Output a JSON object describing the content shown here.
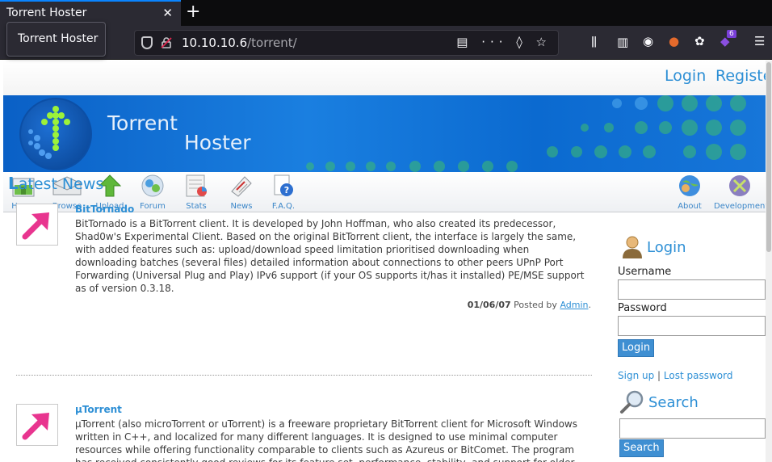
{
  "browser": {
    "tab_title": "Torrent Hoster",
    "tooltip": "Torrent Hoster",
    "url_host": "10.10.10.6",
    "url_path": "/torrent/",
    "extension_badge": "6"
  },
  "site": {
    "top_links": {
      "login": "Login",
      "register": "Register"
    },
    "banner": {
      "title_line1": "Torrent",
      "title_line2": "Hoster"
    },
    "nav": [
      {
        "label": "Home",
        "icon": "home-icon"
      },
      {
        "label": "Browse",
        "icon": "browse-icon"
      },
      {
        "label": "Upload",
        "icon": "upload-icon"
      },
      {
        "label": "Forum",
        "icon": "forum-icon"
      },
      {
        "label": "Stats",
        "icon": "stats-icon"
      },
      {
        "label": "News",
        "icon": "news-icon"
      },
      {
        "label": "F.A.Q.",
        "icon": "faq-icon"
      }
    ],
    "nav_right": [
      {
        "label": "About",
        "icon": "about-icon"
      },
      {
        "label": "Development",
        "icon": "development-icon"
      }
    ]
  },
  "news": {
    "heading_first": "L",
    "heading_rest": "atest News",
    "items": [
      {
        "title": "BitTornado",
        "body": "BitTornado is a BitTorrent client. It is developed by John Hoffman, who also created its predecessor, Shad0w's Experimental Client. Based on the original BitTorrent client, the interface is largely the same, with added features such as: upload/download speed limitation prioritised downloading when downloading batches (several files) detailed information about connections to other peers UPnP Port Forwarding (Universal Plug and Play) IPv6 support (if your OS supports it/has it installed) PE/MSE support as of version 0.3.18.",
        "date": "01/06/07",
        "posted_by": "Posted by",
        "author": "Admin"
      },
      {
        "title": "µTorrent",
        "body": "µTorrent (also microTorrent or uTorrent) is a freeware proprietary BitTorrent client for Microsoft Windows written in C++, and localized for many different languages. It is designed to use minimal computer resources while offering functionality comparable to clients such as Azureus or BitComet. The program has received consistently good reviews for its feature set, performance, stability, and support for older hardware and"
      }
    ]
  },
  "sidebar": {
    "login_heading": "Login",
    "username_label": "Username",
    "password_label": "Password",
    "login_button": "Login",
    "signup_link": "Sign up",
    "separator": "|",
    "lost_password_link": "Lost password",
    "search_heading": "Search",
    "search_button": "Search"
  },
  "colors": {
    "accent": "#2d8fd5",
    "banner_blue": "#0a60c6",
    "dot_green": "#2bb870",
    "arrow_pink": "#e8358f"
  }
}
